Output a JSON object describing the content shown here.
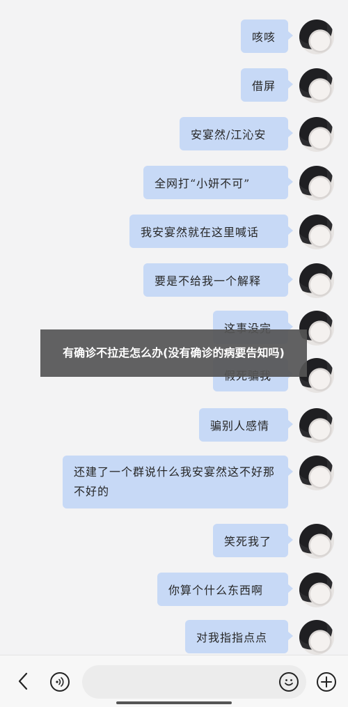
{
  "messages": [
    {
      "text": "咳咳"
    },
    {
      "text": "借屏"
    },
    {
      "text": "安宴然/江沁安"
    },
    {
      "text": "全网打“小妍不可”"
    },
    {
      "text": "我安宴然就在这里喊话"
    },
    {
      "text": "要是不给我一个解释"
    },
    {
      "text": "这事没完"
    },
    {
      "text": "假死骗我"
    },
    {
      "text": "骗别人感情"
    },
    {
      "text": "还建了一个群说什么我安宴然这不好那不好的"
    },
    {
      "text": "笑死我了"
    },
    {
      "text": "你算个什么东西啊"
    },
    {
      "text": "对我指指点点"
    }
  ],
  "banner": {
    "title": "有确诊不拉走怎么办(没有确诊的病要告知吗)"
  },
  "input_bar": {
    "back_icon": "chevron-left-icon",
    "voice_icon": "voice-wave-icon",
    "message_placeholder": "",
    "emoji_icon": "smiley-icon",
    "plus_icon": "plus-circle-icon"
  },
  "colors": {
    "bubble": "#c7d9f6",
    "background": "#f3f3f4",
    "banner": "#555555"
  }
}
